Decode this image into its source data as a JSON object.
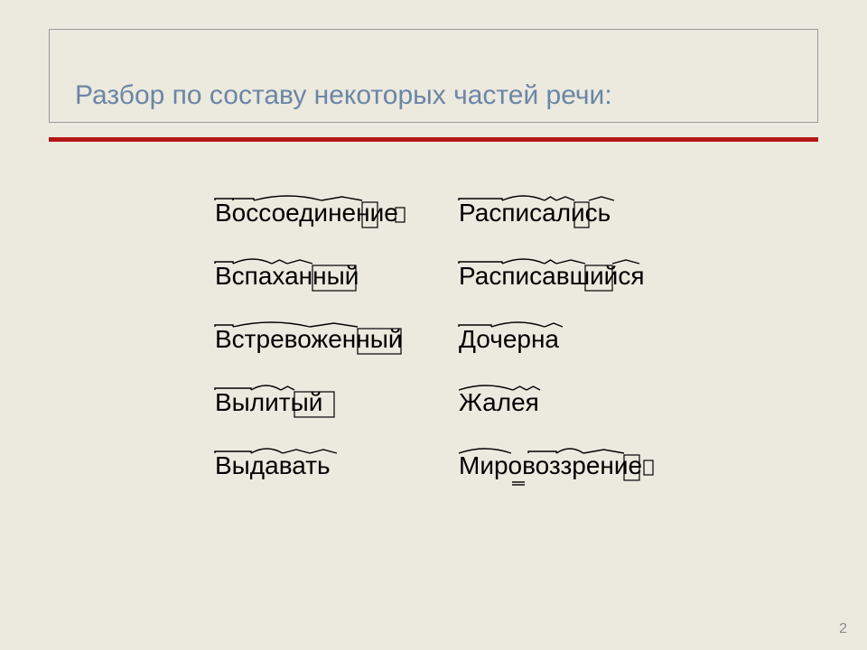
{
  "slide": {
    "title": "Разбор по составу некоторых частей речи:",
    "page_number": "2"
  },
  "words": {
    "r0c0": "Воссоединение",
    "r0c1": "Расписались",
    "r1c0": "Вспаханный",
    "r1c1": "Расписавшийся",
    "r2c0": "Встревоженный",
    "r2c1": "Дочерна",
    "r3c0": "Вылитый",
    "r3c1": "Жалея",
    "r4c0": "Выдавать",
    "r4c1": "Мировоззрение"
  },
  "morphemes": {
    "r0c0": [
      {
        "type": "prefix",
        "start": 0,
        "end": 20
      },
      {
        "type": "prefix",
        "start": 20,
        "end": 43
      },
      {
        "type": "root",
        "start": 43,
        "end": 118
      },
      {
        "type": "suffix",
        "start": 118,
        "end": 163
      },
      {
        "type": "box",
        "start": 163,
        "end": 180
      },
      {
        "type": "ending_empty",
        "at": 200
      }
    ],
    "r0c1": [
      {
        "type": "prefix",
        "start": 0,
        "end": 48
      },
      {
        "type": "root",
        "start": 48,
        "end": 95
      },
      {
        "type": "suffix",
        "start": 95,
        "end": 108
      },
      {
        "type": "suffix",
        "start": 108,
        "end": 128
      },
      {
        "type": "box",
        "start": 128,
        "end": 144
      },
      {
        "type": "suffix",
        "start": 144,
        "end": 172
      }
    ],
    "r1c0": [
      {
        "type": "prefix",
        "start": 0,
        "end": 20
      },
      {
        "type": "root",
        "start": 20,
        "end": 63
      },
      {
        "type": "suffix",
        "start": 63,
        "end": 80
      },
      {
        "type": "suffix",
        "start": 80,
        "end": 108
      },
      {
        "type": "box",
        "start": 108,
        "end": 156
      }
    ],
    "r1c1": [
      {
        "type": "prefix",
        "start": 0,
        "end": 48
      },
      {
        "type": "root",
        "start": 48,
        "end": 95
      },
      {
        "type": "suffix",
        "start": 95,
        "end": 108
      },
      {
        "type": "suffix",
        "start": 108,
        "end": 140
      },
      {
        "type": "box",
        "start": 140,
        "end": 170
      },
      {
        "type": "suffix",
        "start": 170,
        "end": 200
      }
    ],
    "r2c0": [
      {
        "type": "prefix",
        "start": 0,
        "end": 20
      },
      {
        "type": "root",
        "start": 20,
        "end": 105
      },
      {
        "type": "suffix",
        "start": 105,
        "end": 158
      },
      {
        "type": "box",
        "start": 158,
        "end": 206
      }
    ],
    "r2c1": [
      {
        "type": "prefix",
        "start": 0,
        "end": 36
      },
      {
        "type": "root",
        "start": 36,
        "end": 95
      },
      {
        "type": "suffix",
        "start": 95,
        "end": 115
      }
    ],
    "r3c0": [
      {
        "type": "prefix",
        "start": 0,
        "end": 40
      },
      {
        "type": "root",
        "start": 40,
        "end": 73
      },
      {
        "type": "suffix",
        "start": 73,
        "end": 88
      },
      {
        "type": "box",
        "start": 88,
        "end": 132
      }
    ],
    "r3c1": [
      {
        "type": "root",
        "start": 0,
        "end": 60
      },
      {
        "type": "suffix",
        "start": 60,
        "end": 75
      },
      {
        "type": "suffix",
        "start": 75,
        "end": 90
      }
    ],
    "r4c0": [
      {
        "type": "prefix",
        "start": 0,
        "end": 40
      },
      {
        "type": "root",
        "start": 40,
        "end": 75
      },
      {
        "type": "suffix",
        "start": 75,
        "end": 105
      },
      {
        "type": "suffix",
        "start": 105,
        "end": 135
      }
    ],
    "r4c1": [
      {
        "type": "root",
        "start": 0,
        "end": 58
      },
      {
        "type": "connector",
        "at": 66
      },
      {
        "type": "prefix",
        "start": 77,
        "end": 108
      },
      {
        "type": "root",
        "start": 108,
        "end": 138
      },
      {
        "type": "suffix",
        "start": 138,
        "end": 183
      },
      {
        "type": "box",
        "start": 183,
        "end": 200
      },
      {
        "type": "ending_empty",
        "at": 205
      }
    ]
  }
}
